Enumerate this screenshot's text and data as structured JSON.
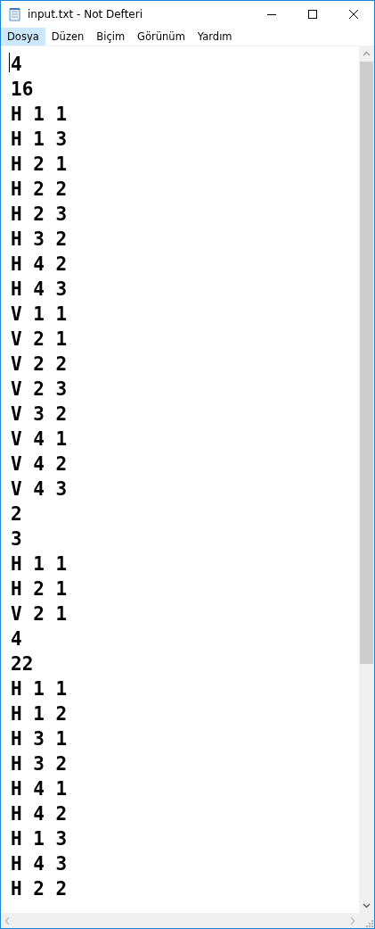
{
  "window": {
    "title": "input.txt - Not Defteri"
  },
  "menu": [
    {
      "label": "Dosya",
      "selected": true
    },
    {
      "label": "Düzen",
      "selected": false
    },
    {
      "label": "Biçim",
      "selected": false
    },
    {
      "label": "Görünüm",
      "selected": false
    },
    {
      "label": "Yardım",
      "selected": false
    }
  ],
  "editor": {
    "lines": [
      "4",
      "16",
      "H 1 1",
      "H 1 3",
      "H 2 1",
      "H 2 2",
      "H 2 3",
      "H 3 2",
      "H 4 2",
      "H 4 3",
      "V 1 1",
      "V 2 1",
      "V 2 2",
      "V 2 3",
      "V 3 2",
      "V 4 1",
      "V 4 2",
      "V 4 3",
      "2",
      "3",
      "H 1 1",
      "H 2 1",
      "V 2 1",
      "4",
      "22",
      "H 1 1",
      "H 1 2",
      "H 3 1",
      "H 3 2",
      "H 4 1",
      "H 4 2",
      "H 1 3",
      "H 4 3",
      "H 2 2"
    ]
  }
}
